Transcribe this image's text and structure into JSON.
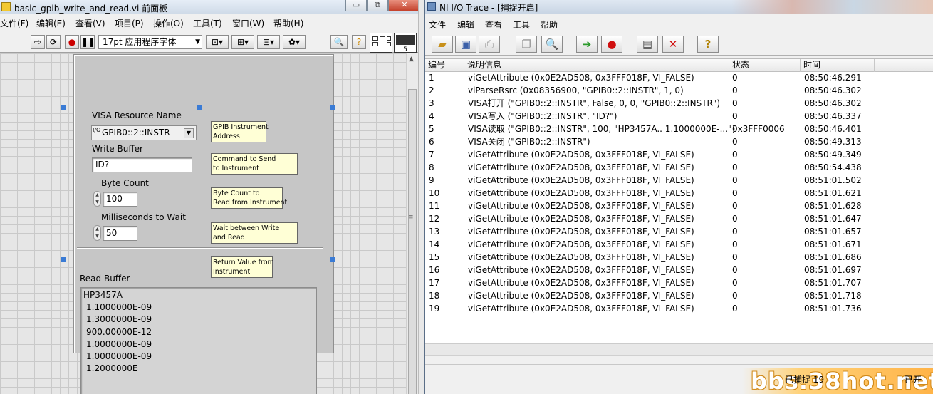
{
  "labview": {
    "title": "basic_gpib_write_and_read.vi 前面板",
    "window_buttons": {
      "minimize": "▭",
      "restore": "⧉",
      "close": "✕"
    },
    "menus": [
      "文件(F)",
      "编辑(E)",
      "查看(V)",
      "项目(P)",
      "操作(O)",
      "工具(T)",
      "窗口(W)",
      "帮助(H)"
    ],
    "toolbar": {
      "font": "17pt 应用程序字体",
      "conn_number": "5"
    },
    "controls": {
      "visa_label": "VISA Resource Name",
      "visa_io": "I/O",
      "visa_value": "GPIB0::2::INSTR",
      "write_label": "Write Buffer",
      "write_value": "ID?",
      "bytecount_label": "Byte Count",
      "bytecount_value": "100",
      "wait_label": "Milliseconds to Wait",
      "wait_value": "50",
      "read_label": "Read Buffer",
      "read_lines": [
        "HP3457A",
        "1.1000000E-09",
        "1.3000000E-09",
        "900.00000E-12",
        "1.0000000E-09",
        "1.0000000E-09",
        "1.2000000E"
      ]
    },
    "notes": {
      "n1": [
        "GPIB Instrument",
        "Address"
      ],
      "n2": [
        "Command to Send",
        "to Instrument"
      ],
      "n3": [
        "Byte Count to",
        "Read from Instrument"
      ],
      "n4": [
        "Wait between Write",
        "and Read"
      ],
      "n5": [
        "Return Value from",
        "Instrument"
      ]
    }
  },
  "iotrace": {
    "title": "NI I/O Trace - [捕捉开启]",
    "menus": [
      "文件",
      "编辑",
      "查看",
      "工具",
      "帮助"
    ],
    "columns": [
      "编号",
      "说明信息",
      "状态",
      "时间"
    ],
    "rows": [
      [
        "1",
        "viGetAttribute (0x0E2AD508, 0x3FFF018F, VI_FALSE)",
        "0",
        "08:50:46.291"
      ],
      [
        "2",
        "viParseRsrc (0x08356900, \"GPIB0::2::INSTR\", 1, 0)",
        "0",
        "08:50:46.302"
      ],
      [
        "3",
        "VISA打开 (\"GPIB0::2::INSTR\", False, 0, 0, \"GPIB0::2::INSTR\")",
        "0",
        "08:50:46.302"
      ],
      [
        "4",
        "VISA写入 (\"GPIB0::2::INSTR\", \"ID?\")",
        "0",
        "08:50:46.337"
      ],
      [
        "5",
        "VISA读取 (\"GPIB0::2::INSTR\", 100, \"HP3457A.. 1.1000000E-...\")",
        "0x3FFF0006",
        "08:50:46.401"
      ],
      [
        "6",
        "VISA关闭 (\"GPIB0::2::INSTR\")",
        "0",
        "08:50:49.313"
      ],
      [
        "7",
        "viGetAttribute (0x0E2AD508, 0x3FFF018F, VI_FALSE)",
        "0",
        "08:50:49.349"
      ],
      [
        "8",
        "viGetAttribute (0x0E2AD508, 0x3FFF018F, VI_FALSE)",
        "0",
        "08:50:54.438"
      ],
      [
        "9",
        "viGetAttribute (0x0E2AD508, 0x3FFF018F, VI_FALSE)",
        "0",
        "08:51:01.502"
      ],
      [
        "10",
        "viGetAttribute (0x0E2AD508, 0x3FFF018F, VI_FALSE)",
        "0",
        "08:51:01.621"
      ],
      [
        "11",
        "viGetAttribute (0x0E2AD508, 0x3FFF018F, VI_FALSE)",
        "0",
        "08:51:01.628"
      ],
      [
        "12",
        "viGetAttribute (0x0E2AD508, 0x3FFF018F, VI_FALSE)",
        "0",
        "08:51:01.647"
      ],
      [
        "13",
        "viGetAttribute (0x0E2AD508, 0x3FFF018F, VI_FALSE)",
        "0",
        "08:51:01.657"
      ],
      [
        "14",
        "viGetAttribute (0x0E2AD508, 0x3FFF018F, VI_FALSE)",
        "0",
        "08:51:01.671"
      ],
      [
        "15",
        "viGetAttribute (0x0E2AD508, 0x3FFF018F, VI_FALSE)",
        "0",
        "08:51:01.686"
      ],
      [
        "16",
        "viGetAttribute (0x0E2AD508, 0x3FFF018F, VI_FALSE)",
        "0",
        "08:51:01.697"
      ],
      [
        "17",
        "viGetAttribute (0x0E2AD508, 0x3FFF018F, VI_FALSE)",
        "0",
        "08:51:01.707"
      ],
      [
        "18",
        "viGetAttribute (0x0E2AD508, 0x3FFF018F, VI_FALSE)",
        "0",
        "08:51:01.718"
      ],
      [
        "19",
        "viGetAttribute (0x0E2AD508, 0x3FFF018F, VI_FALSE)",
        "0",
        "08:51:01.736"
      ]
    ],
    "status_left": "已捕捉 19",
    "status_right": "已开"
  },
  "watermark": "bbs.38hot.net"
}
